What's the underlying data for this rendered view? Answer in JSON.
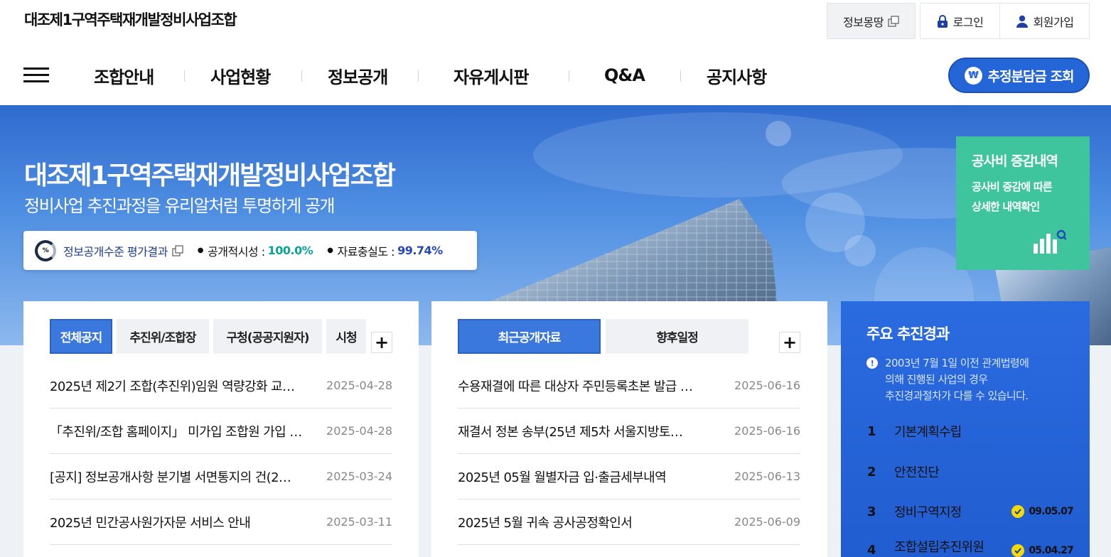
{
  "header": {
    "site_title": "대조제1구역주택재개발정비사업조합",
    "util": {
      "info": "정보몽땅",
      "login": "로그인",
      "join": "회원가입"
    },
    "nav": [
      "조합안내",
      "사업현황",
      "정보공개",
      "자유게시판",
      "Q&A",
      "공지사항"
    ],
    "estimate_button": "추정분담금 조회",
    "won_symbol": "₩"
  },
  "hero": {
    "title": "대조제1구역주택재개발정비사업조합",
    "subtitle": "정비사업 추진과정을 유리알처럼 투명하게 공개",
    "evaluation": {
      "icon_text": "%",
      "link": "정보공개수준 평가결과",
      "openness_label": "공개적시성 :",
      "openness_value": "100.0%",
      "fidelity_label": "자료충실도 :",
      "fidelity_value": "99.74%"
    },
    "cost_card": {
      "title": "공사비 증감내역",
      "line1": "공사비 증감에 따른",
      "line2": "상세한 내역확인"
    }
  },
  "notice_panel": {
    "tabs": [
      "전체공지",
      "추진위/조합장",
      "구청(공공지원자)",
      "시청"
    ],
    "plus": "+",
    "rows": [
      {
        "title": "2025년 제2기 조합(추진위)임원 역량강화 교…",
        "date": "2025-04-28"
      },
      {
        "title": "「추진위/조합 홈페이지」 미가입 조합원 가입 …",
        "date": "2025-04-28"
      },
      {
        "title": "[공지] 정보공개사항 분기별 서면통지의 건(2…",
        "date": "2025-03-24"
      },
      {
        "title": "2025년 민간공사원가자문 서비스 안내",
        "date": "2025-03-11"
      }
    ]
  },
  "data_panel": {
    "tabs": [
      "최근공개자료",
      "향후일정"
    ],
    "plus": "+",
    "rows": [
      {
        "title": "수용재결에 따른 대상자 주민등록초본 발급 …",
        "date": "2025-06-16"
      },
      {
        "title": "재결서 정본 송부(25년 제5차 서울지방토…",
        "date": "2025-06-16"
      },
      {
        "title": "2025년 05월 월별자금 입·출금세부내역",
        "date": "2025-06-13"
      },
      {
        "title": "2025년 5월 귀속 공사공정확인서",
        "date": "2025-06-09"
      }
    ]
  },
  "progress": {
    "title": "주요 추진경과",
    "note_icon": "!",
    "note_lines": [
      "2003년 7월 1일 이전 관계법령에",
      "의해 진행된 사업의 경우",
      "추진경과절차가 다를 수 있습니다."
    ],
    "steps": [
      {
        "num": "1",
        "label": "기본계획수립",
        "date": ""
      },
      {
        "num": "2",
        "label": "안전진단",
        "date": ""
      },
      {
        "num": "3",
        "label": "정비구역지정",
        "date": "09.05.07"
      },
      {
        "num": "4",
        "label": "조합설립추진위원",
        "date": "05.04.27"
      }
    ]
  },
  "colors": {
    "accent_blue": "#2465d8",
    "teal_card": "#3ec59d",
    "progress_bg": "#1f5ccf",
    "check_yellow": "#f5d90a"
  }
}
